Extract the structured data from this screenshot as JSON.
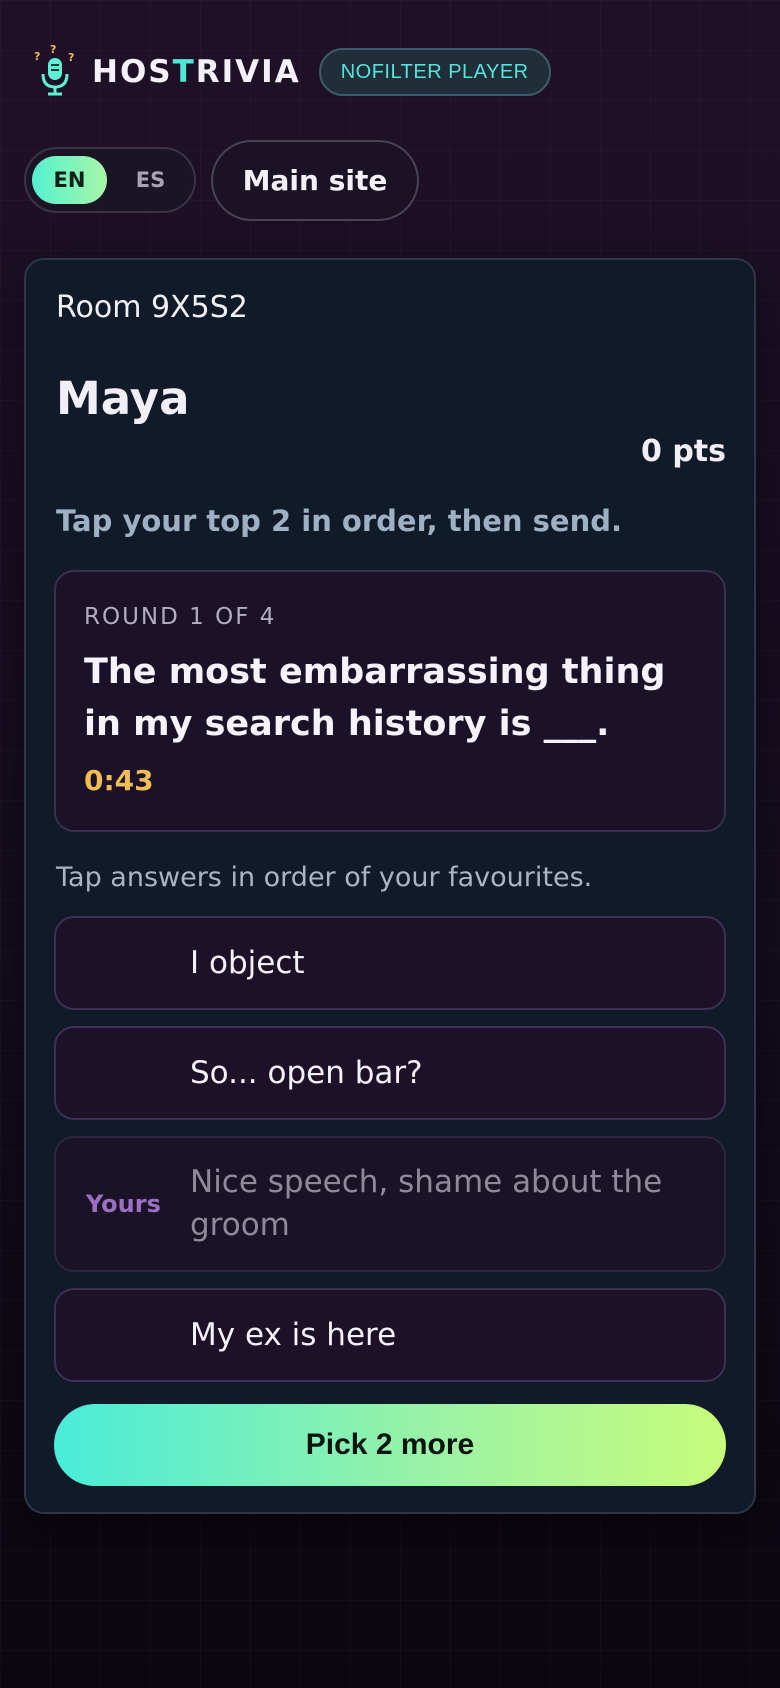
{
  "header": {
    "brand_prefix": "HOS",
    "brand_accent": "T",
    "brand_suffix": "RIVIA",
    "mode_badge": "NOFILTER PLAYER"
  },
  "language": {
    "active": "EN",
    "inactive": "ES"
  },
  "nav": {
    "main_site_label": "Main site"
  },
  "player": {
    "room": "Room 9X5S2",
    "name": "Maya",
    "points": "0 pts"
  },
  "instruction": "Tap your top 2 in order, then send.",
  "round": {
    "label": "ROUND 1 OF 4",
    "prompt": "The most embarrassing thing in my search history is ___.",
    "timer": "0:43"
  },
  "answers_hint": "Tap answers in order of your favourites.",
  "answers": [
    {
      "text": "I object",
      "tag": ""
    },
    {
      "text": "So... open bar?",
      "tag": ""
    },
    {
      "text": "Nice speech, shame about the groom",
      "tag": "Yours"
    },
    {
      "text": "My ex is here",
      "tag": ""
    }
  ],
  "submit_label": "Pick 2 more",
  "colors": {
    "accent_teal": "#4fe8d4",
    "accent_lime": "#c7fc7b",
    "timer_amber": "#f2bd55",
    "own_tag_purple": "#9b6fc4"
  },
  "icons": {
    "logo": "microphone-icon"
  }
}
